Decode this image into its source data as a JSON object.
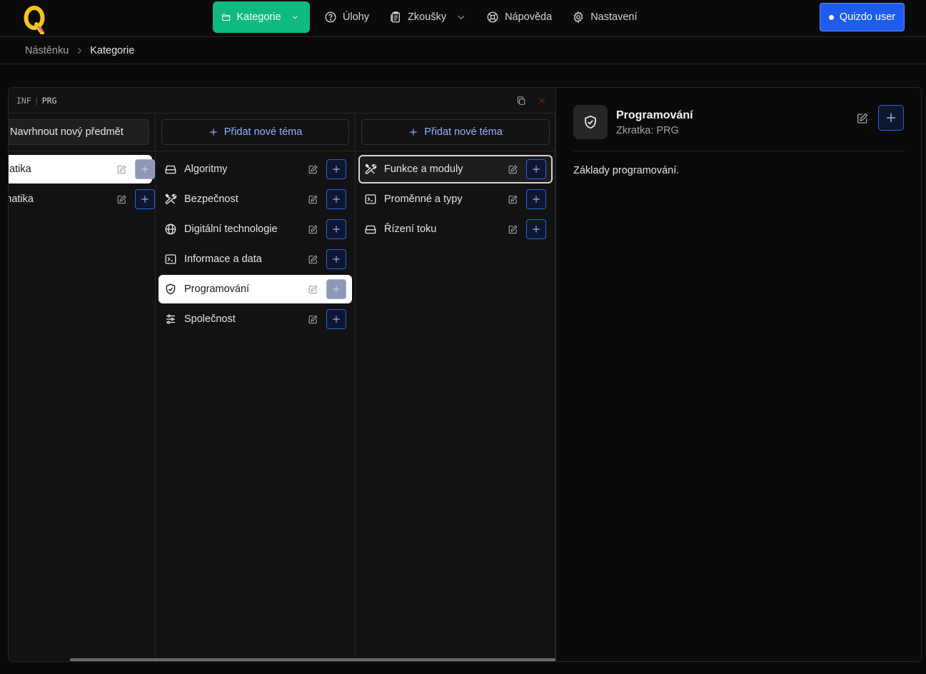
{
  "nav": {
    "items": [
      {
        "label": "Kategorie",
        "icon": "folder-icon",
        "active": true
      },
      {
        "label": "Úlohy",
        "icon": "question-circle-icon"
      },
      {
        "label": "Zkoušky",
        "icon": "clipboard-icon"
      },
      {
        "label": "Nápověda",
        "icon": "lifebuoy-icon"
      },
      {
        "label": "Nastavení",
        "icon": "gear-icon"
      }
    ],
    "user_label": "Quizdo user"
  },
  "breadcrumb": {
    "home": "Nástěnku",
    "current": "Kategorie"
  },
  "miller": {
    "path": {
      "root": "INF",
      "separator": "|",
      "current": "PRG"
    },
    "columns": {
      "subjects": {
        "button": "Navrhnout nový předmět",
        "items": [
          {
            "label": "Informatika",
            "selected": true
          },
          {
            "label": "Matematika",
            "selected": false
          }
        ]
      },
      "topics": {
        "button": "Přidat nové téma",
        "items": [
          {
            "label": "Algoritmy",
            "icon": "hard-drive-icon"
          },
          {
            "label": "Bezpečnost",
            "icon": "tools-icon"
          },
          {
            "label": "Digitální technologie",
            "icon": "globe-icon"
          },
          {
            "label": "Informace a data",
            "icon": "terminal-icon"
          },
          {
            "label": "Programování",
            "icon": "shield-check-icon",
            "selected": true
          },
          {
            "label": "Společnost",
            "icon": "sliders-icon"
          }
        ]
      },
      "subtopics": {
        "button": "Přidat nové téma",
        "items": [
          {
            "label": "Funkce a moduly",
            "icon": "tools-icon",
            "focused": true
          },
          {
            "label": "Proměnné a typy",
            "icon": "terminal-icon"
          },
          {
            "label": "Řízení toku",
            "icon": "hard-drive-icon"
          }
        ]
      }
    }
  },
  "detail": {
    "title": "Programování",
    "abbreviation": "Zkratka: PRG",
    "description": "Základy programování."
  },
  "colors": {
    "accent": "#10b981",
    "primary": "#1e5cf0",
    "link": "#8fb1ff"
  }
}
